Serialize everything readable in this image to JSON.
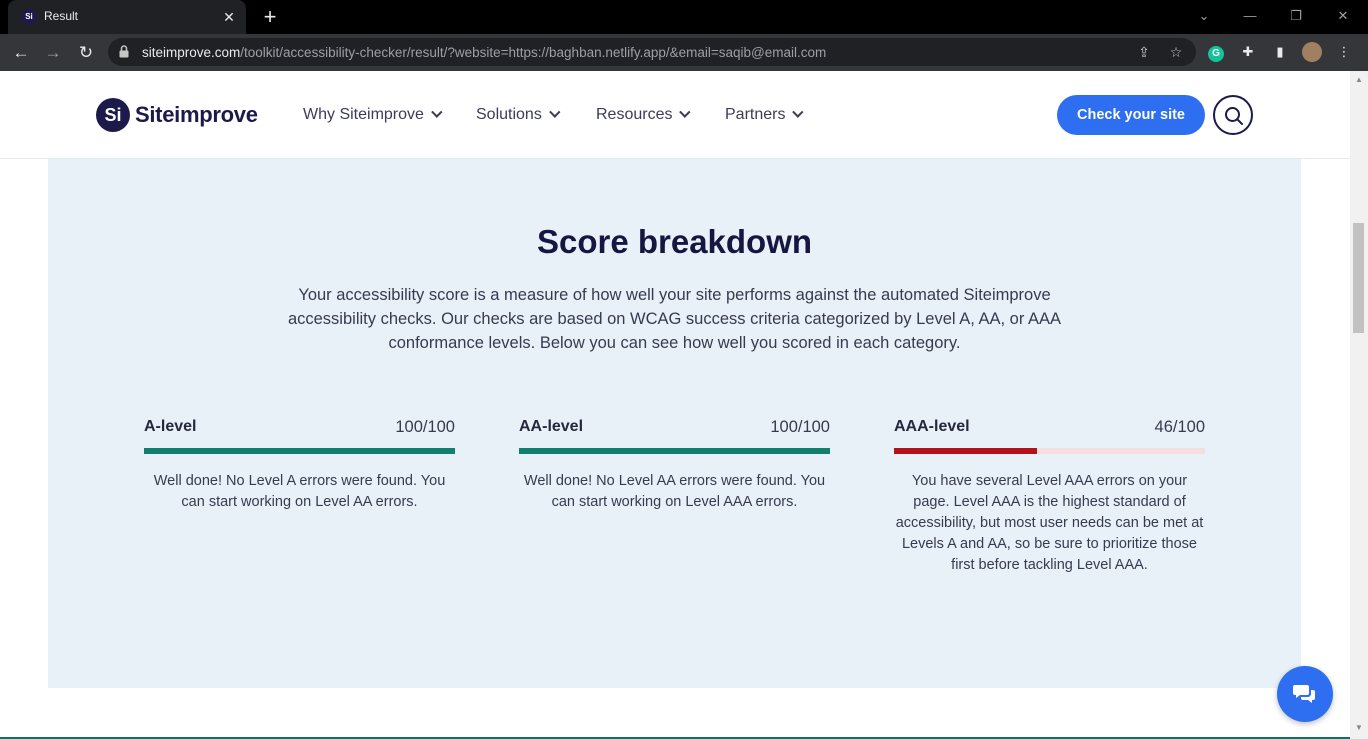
{
  "browser": {
    "tab_title": "Result",
    "tab_favicon_text": "Si",
    "url_host": "siteimprove.com",
    "url_path": "/toolkit/accessibility-checker/result/?website=https://baghban.netlify.app/&email=saqib@email.com"
  },
  "header": {
    "logo_mark": "Si",
    "logo_text": "Siteimprove",
    "nav": [
      {
        "label": "Why Siteimprove"
      },
      {
        "label": "Solutions"
      },
      {
        "label": "Resources"
      },
      {
        "label": "Partners"
      }
    ],
    "cta_label": "Check your site"
  },
  "section": {
    "title": "Score breakdown",
    "intro": "Your accessibility score is a measure of how well your site performs against the automated Siteimprove accessibility checks. Our checks are based on WCAG success criteria categorized by Level A, AA, or AAA conformance levels. Below you can see how well you scored in each category."
  },
  "levels": [
    {
      "name": "A-level",
      "score_text": "100/100",
      "score_fraction": 1.0,
      "color": "#12806f",
      "description": "Well done! No Level A errors were found. You can start working on Level AA errors."
    },
    {
      "name": "AA-level",
      "score_text": "100/100",
      "score_fraction": 1.0,
      "color": "#12806f",
      "description": "Well done! No Level AA errors were found. You can start working on Level AAA errors."
    },
    {
      "name": "AAA-level",
      "score_text": "46/100",
      "score_fraction": 0.46,
      "color": "#b3111e",
      "description": "You have several Level AAA errors on your page. Level AAA is the highest standard of accessibility, but most user needs can be met at Levels A and AA, so be sure to prioritize those first before tackling Level AAA."
    }
  ],
  "colors": {
    "accent": "#2d6ff0",
    "brand": "#1b1a4a",
    "panel": "#e9f1f8",
    "pass": "#12806f",
    "fail": "#b3111e"
  }
}
